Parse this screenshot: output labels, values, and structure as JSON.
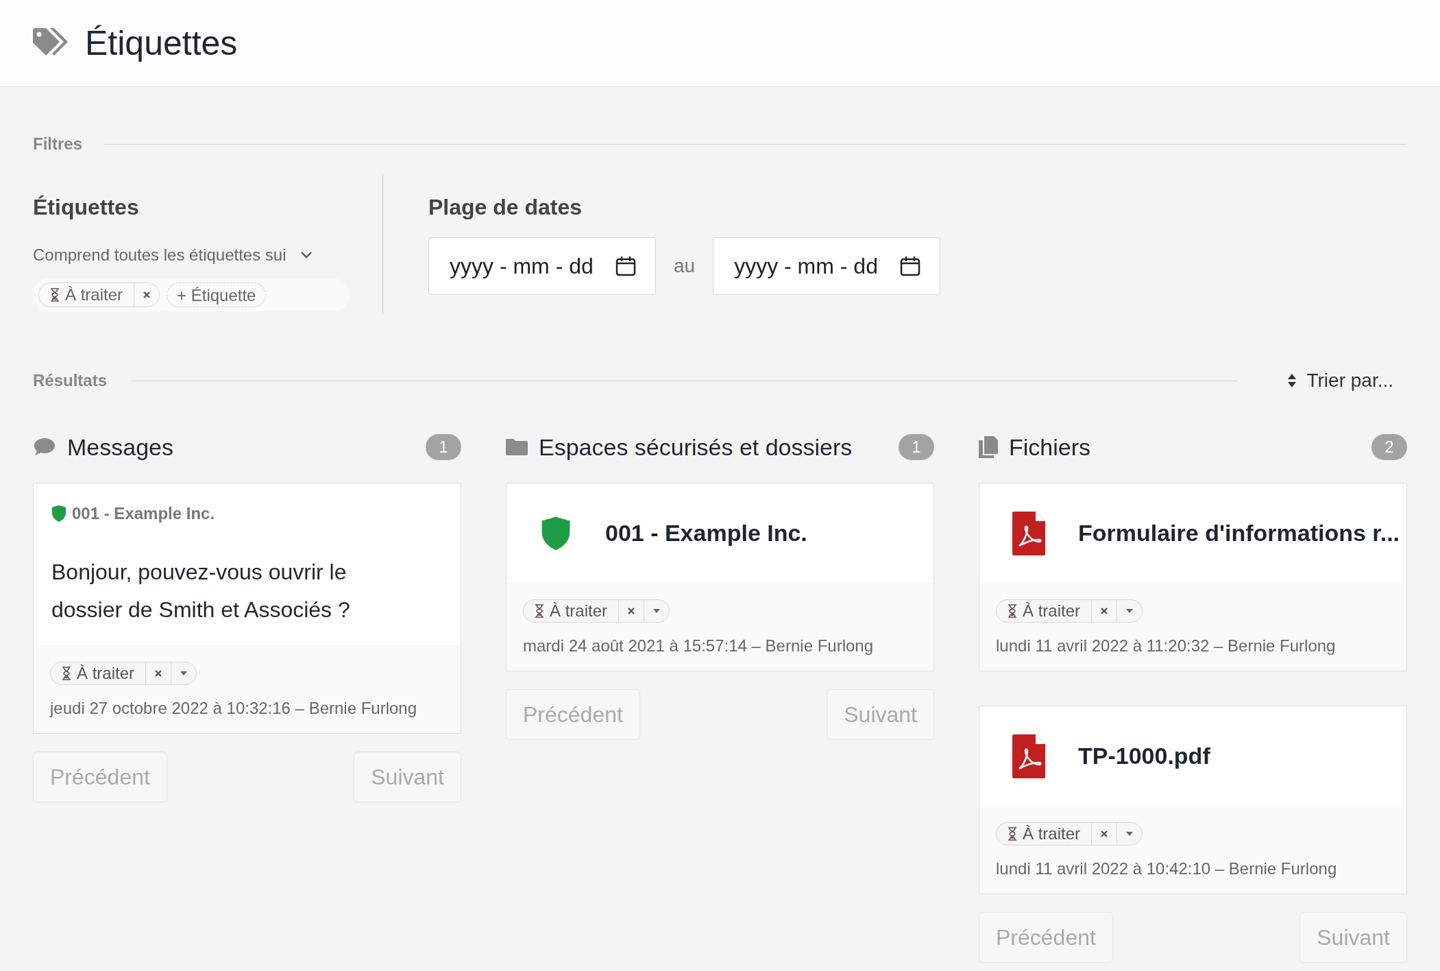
{
  "header": {
    "title": "Étiquettes"
  },
  "filters": {
    "label": "Filtres",
    "tags_filter": {
      "heading": "Étiquettes",
      "mode": "Comprend toutes les étiquettes sui",
      "tags": [
        {
          "label": "À traiter"
        }
      ],
      "add_button": "+ Étiquette"
    },
    "date_range": {
      "heading": "Plage de dates",
      "from": {
        "placeholder": "yyyy - mm - dd"
      },
      "separator": "au",
      "to": {
        "placeholder": "yyyy - mm - dd"
      }
    }
  },
  "results": {
    "label": "Résultats",
    "sort_button": "Trier par..."
  },
  "columns": [
    {
      "kind": "messages",
      "title": "Messages",
      "count": "1",
      "items": [
        {
          "kind": "message",
          "space": "001 - Example Inc.",
          "body": "Bonjour, pouvez-vous ouvrir le dossier de Smith et Associés ?",
          "tag": "À traiter",
          "meta": "jeudi 27 octobre 2022 à 10:32:16 – Bernie Furlong"
        }
      ],
      "prev": {
        "label": "Précédent",
        "disabled": true
      },
      "next": {
        "label": "Suivant",
        "disabled": true
      }
    },
    {
      "kind": "spaces",
      "title": "Espaces sécurisés et dossiers",
      "count": "1",
      "items": [
        {
          "kind": "space",
          "title": "001 - Example Inc.",
          "tag": "À traiter",
          "meta": "mardi 24 août 2021 à 15:57:14 – Bernie Furlong"
        }
      ],
      "prev": {
        "label": "Précédent",
        "disabled": true
      },
      "next": {
        "label": "Suivant",
        "disabled": true
      }
    },
    {
      "kind": "files",
      "title": "Fichiers",
      "count": "2",
      "items": [
        {
          "kind": "file",
          "title": "Formulaire d'informations r...",
          "tag": "À traiter",
          "meta": "lundi 11 avril 2022 à 11:20:32 – Bernie Furlong"
        },
        {
          "kind": "file",
          "title": "TP-1000.pdf",
          "tag": "À traiter",
          "meta": "lundi 11 avril 2022 à 10:42:10 – Bernie Furlong"
        }
      ],
      "prev": {
        "label": "Précédent",
        "disabled": true
      },
      "next": {
        "label": "Suivant",
        "disabled": true
      }
    }
  ]
}
